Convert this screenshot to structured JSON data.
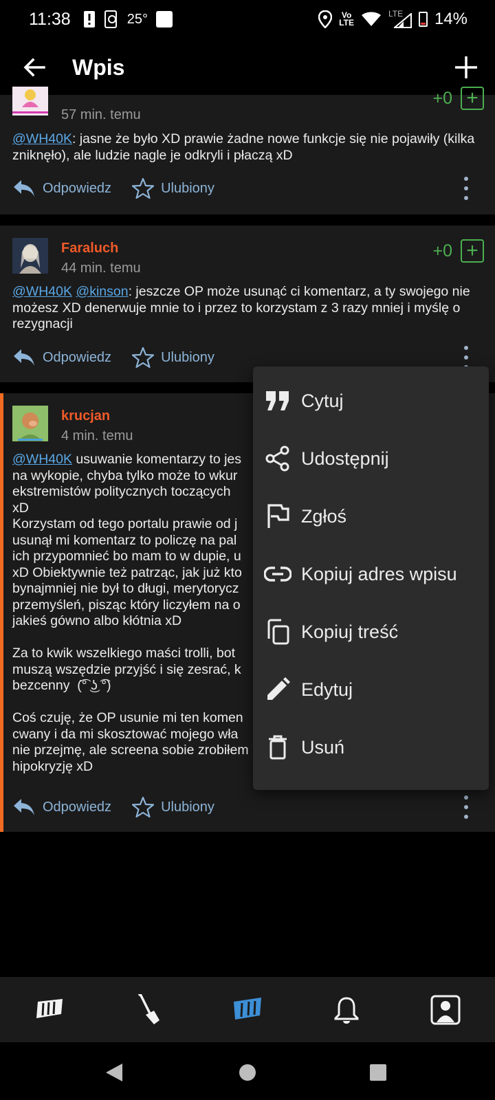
{
  "status_bar": {
    "time": "11:38",
    "temperature": "25°",
    "network_top": "Vo",
    "network_bottom": "LTE",
    "signal_label": "LTE",
    "battery": "14%"
  },
  "app_bar": {
    "title": "Wpis"
  },
  "comments": [
    {
      "username": "",
      "time_ago": "57 min. temu",
      "vote_count": "+0",
      "mention1": "@WH40K",
      "text": ": jasne że było XD prawie żadne nowe funkcje się nie pojawiły (kilka zniknęło), ale ludzie nagle je odkryli i płaczą xD",
      "reply_label": "Odpowiedz",
      "favorite_label": "Ulubiony"
    },
    {
      "username": "Faraluch",
      "time_ago": "44 min. temu",
      "vote_count": "+0",
      "mention1": "@WH40K",
      "mention2": "@kinson",
      "text": ": jeszcze OP może usunąć ci komentarz, a ty swojego nie możesz XD denerwuje mnie to i przez to korzystam z 3 razy mniej i myślę o rezygnacji",
      "reply_label": "Odpowiedz",
      "favorite_label": "Ulubiony"
    },
    {
      "username": "krucjan",
      "time_ago": "4 min. temu",
      "mention1": "@WH40K",
      "text": " usuwanie komentarzy to jes\nna wykopie, chyba tylko może to wkur\nekstremistów politycznych toczących\nxD\nKorzystam od tego portalu prawie od j\nusunął mi komentarz to policzę na pal\nich przypomnieć bo mam to w dupie, u\nxD Obiektywnie też patrząc, jak już kto\nbynajmniej nie był to długi, merytorycz\nprzemyśleń, pisząc który liczyłem na o\njakieś gówno albo kłótnia xD\n\nZa to kwik wszelkiego maści trolli, bot\nmuszą wszędzie przyjść i się zesrać, k\nbezcenny  (͡° ͜ʖ ͡°)\n\nCoś czuję, że OP usunie mi ten komen\ncwany i da mi skosztować mojego wła\nnie przejmę, ale screena sobie zrobiłem\nhipokryzję xD",
      "reply_label": "Odpowiedz",
      "favorite_label": "Ulubiony"
    }
  ],
  "context_menu": {
    "items": [
      {
        "label": "Cytuj",
        "icon": "quote-icon"
      },
      {
        "label": "Udostępnij",
        "icon": "share-icon"
      },
      {
        "label": "Zgłoś",
        "icon": "flag-icon"
      },
      {
        "label": "Kopiuj adres wpisu",
        "icon": "link-icon"
      },
      {
        "label": "Kopiuj treść",
        "icon": "copy-icon"
      },
      {
        "label": "Edytuj",
        "icon": "edit-icon"
      },
      {
        "label": "Usuń",
        "icon": "delete-icon"
      }
    ]
  },
  "bottom_nav": {
    "items": [
      "wykop-home-icon",
      "shovel-icon",
      "mikroblog-icon",
      "bell-icon",
      "profile-icon"
    ],
    "active_color": "#3d8fd6"
  },
  "colors": {
    "accent_orange": "#f05a28",
    "vote_green": "#4caf50",
    "link_blue": "#5aa7e6"
  }
}
